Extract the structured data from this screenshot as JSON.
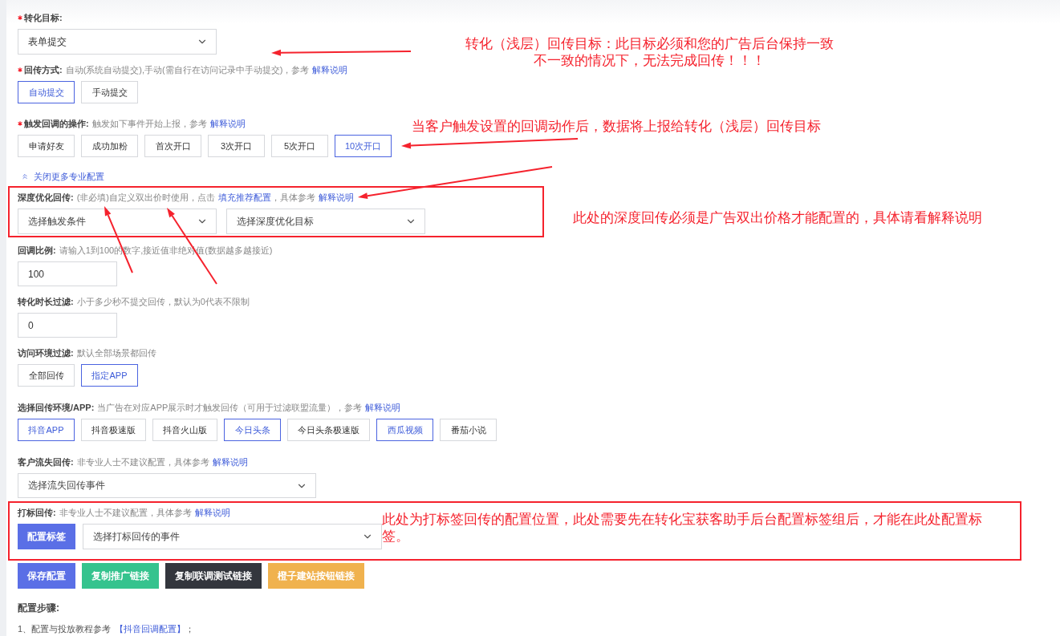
{
  "fields": [
    {
      "kind": "select",
      "required": true,
      "label": "转化目标:",
      "value": "表单提交"
    },
    {
      "kind": "options",
      "required": true,
      "label": "回传方式:",
      "hint": [
        {
          "kind": "text",
          "text": "自动(系统自动提交),手动(需自行在访问记录中手动提交)，参考"
        },
        {
          "kind": "link",
          "text": "解释说明"
        }
      ],
      "options": [
        {
          "label": "自动提交",
          "selected": true
        },
        {
          "label": "手动提交",
          "selected": false
        }
      ]
    },
    {
      "kind": "options",
      "required": true,
      "label": "触发回调的操作:",
      "hint": [
        {
          "kind": "text",
          "text": "触发如下事件开始上报，参考"
        },
        {
          "kind": "link",
          "text": "解释说明"
        }
      ],
      "options": [
        {
          "label": "申请好友",
          "selected": false
        },
        {
          "label": "成功加粉",
          "selected": false
        },
        {
          "label": "首次开口",
          "selected": false
        },
        {
          "label": "3次开口",
          "selected": false
        },
        {
          "label": "5次开口",
          "selected": false
        },
        {
          "label": "10次开口",
          "selected": true
        }
      ]
    },
    {
      "kind": "toggle",
      "label": "关闭更多专业配置"
    },
    {
      "kind": "dual-select",
      "required": false,
      "label": "深度优化回传:",
      "hint": [
        {
          "kind": "text",
          "text": "(非必填)自定义双出价时使用，点击"
        },
        {
          "kind": "link",
          "text": "填充推荐配置"
        },
        {
          "kind": "text",
          "text": "，具体参考"
        },
        {
          "kind": "link",
          "text": "解释说明"
        }
      ],
      "placeholders": [
        "选择触发条件",
        "选择深度优化目标"
      ]
    },
    {
      "kind": "input",
      "required": false,
      "label": "回调比例:",
      "hint": [
        {
          "kind": "text",
          "text": "请输入1到100的数字,接近值非绝对值(数据越多越接近)"
        }
      ],
      "value": "100"
    },
    {
      "kind": "input",
      "required": false,
      "label": "转化时长过滤:",
      "hint": [
        {
          "kind": "text",
          "text": "小于多少秒不提交回传，默认为0代表不限制"
        }
      ],
      "value": "0"
    },
    {
      "kind": "options",
      "required": false,
      "label": "访问环境过滤:",
      "hint": [
        {
          "kind": "text",
          "text": "默认全部场景都回传"
        }
      ],
      "options": [
        {
          "label": "全部回传",
          "selected": false
        },
        {
          "label": "指定APP",
          "selected": true
        }
      ]
    },
    {
      "kind": "options",
      "required": false,
      "label": "选择回传环境/APP:",
      "hint": [
        {
          "kind": "text",
          "text": "当广告在对应APP展示时才触发回传（可用于过滤联盟流量），参考"
        },
        {
          "kind": "link",
          "text": "解释说明"
        }
      ],
      "options": [
        {
          "label": "抖音APP",
          "selected": true
        },
        {
          "label": "抖音极速版",
          "selected": false
        },
        {
          "label": "抖音火山版",
          "selected": false
        },
        {
          "label": "今日头条",
          "selected": true
        },
        {
          "label": "今日头条极速版",
          "selected": false
        },
        {
          "label": "西瓜视频",
          "selected": true
        },
        {
          "label": "番茄小说",
          "selected": false
        }
      ]
    },
    {
      "kind": "select",
      "required": false,
      "label": "客户流失回传:",
      "hint": [
        {
          "kind": "text",
          "text": "非专业人士不建议配置，具体参考"
        },
        {
          "kind": "link",
          "text": "解释说明"
        }
      ],
      "placeholder": "选择流失回传事件"
    },
    {
      "kind": "tag-select",
      "required": false,
      "label": "打标回传:",
      "hint": [
        {
          "kind": "text",
          "text": "非专业人士不建议配置，具体参考"
        },
        {
          "kind": "link",
          "text": "解释说明"
        }
      ],
      "button": "配置标签",
      "placeholder": "选择打标回传的事件"
    }
  ],
  "actions": [
    {
      "label": "保存配置",
      "color": "#5a6fe6"
    },
    {
      "label": "复制推广链接",
      "color": "#35c38e"
    },
    {
      "label": "复制联调测试链接",
      "color": "#33363d"
    },
    {
      "label": "橙子建站按钮链接",
      "color": "#f0b24e"
    }
  ],
  "steps": {
    "title": "配置步骤:",
    "items": [
      {
        "text": "1、配置与投放教程参考 ",
        "link": "【抖音回调配置】",
        "tail": "；"
      }
    ]
  },
  "notes": [
    {
      "lines": [
        "转化（浅层）回传目标：此目标必须和您的广告后台保持一致",
        "不一致的情况下，无法完成回传！！！"
      ]
    },
    {
      "lines": [
        "当客户触发设置的回调动作后，数据将上报给转化（浅层）回传目标"
      ]
    },
    {
      "lines": [
        "此处的深度回传必须是广告双出价格才能配置的，具体请看解释说明"
      ]
    },
    {
      "lines": [
        "此处为打标签回传的配置位置，此处需要先在转化宝获客助手后台配置标签组后，才能在此处配置标签。"
      ]
    }
  ]
}
